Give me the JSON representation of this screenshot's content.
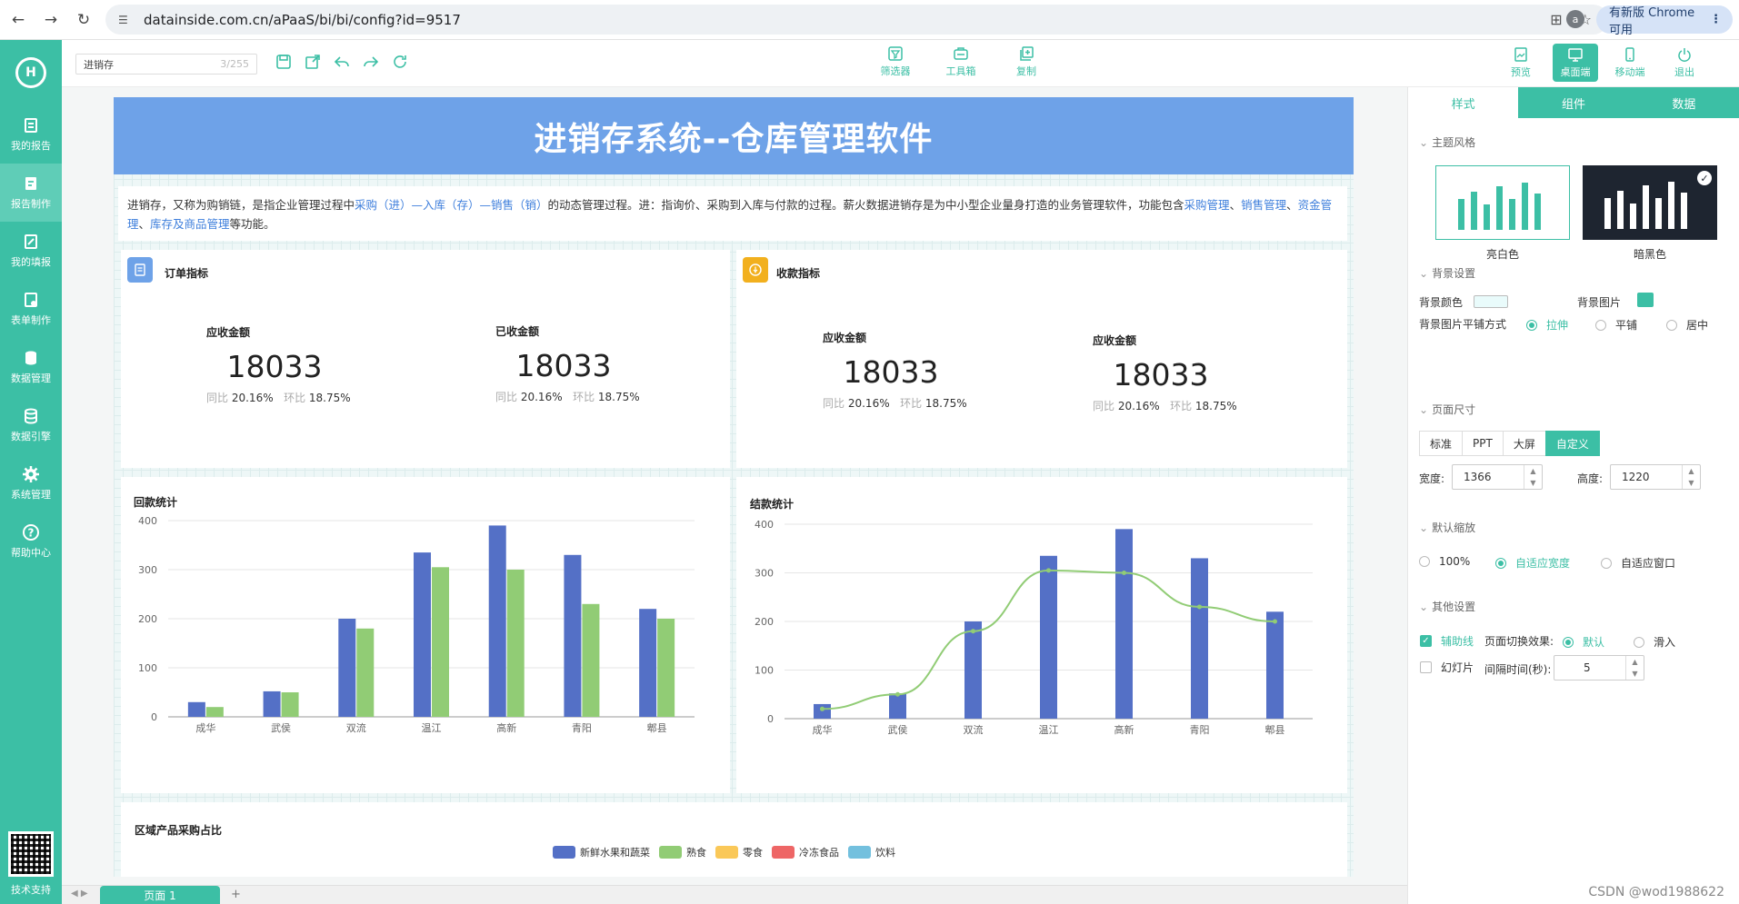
{
  "browser": {
    "url": "datainside.com.cn/aPaaS/bi/bi/config?id=9517",
    "profile_initial": "a",
    "update_label": "有新版 Chrome 可用"
  },
  "sidebar": {
    "items": [
      {
        "label": "我的报告",
        "icon": "report-icon"
      },
      {
        "label": "报告制作",
        "icon": "edit-report-icon"
      },
      {
        "label": "我的填报",
        "icon": "form-fill-icon"
      },
      {
        "label": "表单制作",
        "icon": "form-design-icon"
      },
      {
        "label": "数据管理",
        "icon": "database-icon"
      },
      {
        "label": "数据引擎",
        "icon": "engine-icon"
      },
      {
        "label": "系统管理",
        "icon": "gear-icon"
      },
      {
        "label": "帮助中心",
        "icon": "help-icon"
      }
    ],
    "support_label": "技术支持"
  },
  "toolbar": {
    "report_name": "进销存",
    "name_counter": "3/255",
    "center_tools": [
      "筛选器",
      "工具箱",
      "复制"
    ],
    "right_tools": [
      "预览",
      "桌面端",
      "移动端",
      "退出"
    ]
  },
  "dashboard": {
    "title": "进销存系统--仓库管理软件",
    "intro": {
      "t1": "进销存，又称为购销链，是指企业管理过程中",
      "h1": "采购（进）—入库（存）—销售（销）",
      "t2": "的动态管理过程。进：指询价、采购到入库与付款的过程。薪火数据进销存是为中小型企业量身打造的业务管理软件，功能包含",
      "h2": "采购管理",
      "t3": "、",
      "h3": "销售管理",
      "t4": "、",
      "h4": "资金管理",
      "t5": "、",
      "h5": "库存及商品管理",
      "t6": "等功能。"
    },
    "order_panel": {
      "title": "订单指标",
      "kpis": [
        {
          "label": "应收金额",
          "value": "18033",
          "yoy_label": "同比",
          "yoy": "20.16%",
          "mom_label": "环比",
          "mom": "18.75%"
        },
        {
          "label": "已收金额",
          "value": "18033",
          "yoy_label": "同比",
          "yoy": "20.16%",
          "mom_label": "环比",
          "mom": "18.75%"
        }
      ]
    },
    "collect_panel": {
      "title": "收款指标",
      "kpis": [
        {
          "label": "应收金额",
          "value": "18033",
          "yoy_label": "同比",
          "yoy": "20.16%",
          "mom_label": "环比",
          "mom": "18.75%"
        },
        {
          "label": "应收金额",
          "value": "18033",
          "yoy_label": "同比",
          "yoy": "20.16%",
          "mom_label": "环比",
          "mom": "18.75%"
        }
      ]
    },
    "share_panel": {
      "title": "区域产品采购占比",
      "legend": [
        {
          "name": "新鲜水果和蔬菜",
          "color": "#5470c6"
        },
        {
          "name": "熟食",
          "color": "#91cc75"
        },
        {
          "name": "零食",
          "color": "#fac858"
        },
        {
          "name": "冷冻食品",
          "color": "#ee6666"
        },
        {
          "name": "饮料",
          "color": "#73c0de"
        }
      ]
    }
  },
  "chart_data": [
    {
      "type": "bar",
      "title": "回款统计",
      "categories": [
        "成华",
        "武侯",
        "双流",
        "温江",
        "高新",
        "青阳",
        "郫县"
      ],
      "ylim": [
        0,
        400
      ],
      "yticks": [
        0,
        100,
        200,
        300,
        400
      ],
      "series": [
        {
          "values": [
            30,
            52,
            200,
            335,
            390,
            330,
            220
          ],
          "color": "#5470c6"
        },
        {
          "values": [
            20,
            50,
            180,
            305,
            300,
            230,
            200
          ],
          "color": "#91cc75"
        }
      ]
    },
    {
      "type": "bar",
      "title": "结款统计",
      "categories": [
        "成华",
        "武侯",
        "双流",
        "温江",
        "高新",
        "青阳",
        "郫县"
      ],
      "ylim": [
        0,
        400
      ],
      "yticks": [
        0,
        100,
        200,
        300,
        400
      ],
      "series": [
        {
          "type": "bar",
          "values": [
            30,
            52,
            200,
            335,
            390,
            330,
            220
          ],
          "color": "#5470c6"
        },
        {
          "type": "line",
          "values": [
            20,
            50,
            180,
            305,
            300,
            230,
            200
          ],
          "color": "#91cc75"
        }
      ]
    }
  ],
  "right_panel": {
    "tabs": [
      "样式",
      "组件",
      "数据"
    ],
    "theme": {
      "title": "主题风格",
      "light": "亮白色",
      "dark": "暗黑色"
    },
    "bg": {
      "title": "背景设置",
      "color_label": "背景颜色",
      "image_label": "背景图片",
      "tile_label": "背景图片平铺方式",
      "options": [
        "拉伸",
        "平铺",
        "居中"
      ]
    },
    "size": {
      "title": "页面尺寸",
      "options": [
        "标准",
        "PPT",
        "大屏",
        "自定义"
      ],
      "width_label": "宽度:",
      "width": "1366",
      "height_label": "高度:",
      "height": "1220"
    },
    "zoom": {
      "title": "默认缩放",
      "options": [
        "100%",
        "自适应宽度",
        "自适应窗口"
      ]
    },
    "other": {
      "title": "其他设置",
      "guide_label": "辅助线",
      "switch_label": "页面切换效果:",
      "switch_options": [
        "默认",
        "滑入"
      ],
      "slide_label": "幻灯片",
      "interval_label": "间隔时间(秒):",
      "interval": "5"
    }
  },
  "bottom": {
    "page_tab": "页面 1",
    "watermark": "CSDN @wod1988622"
  }
}
